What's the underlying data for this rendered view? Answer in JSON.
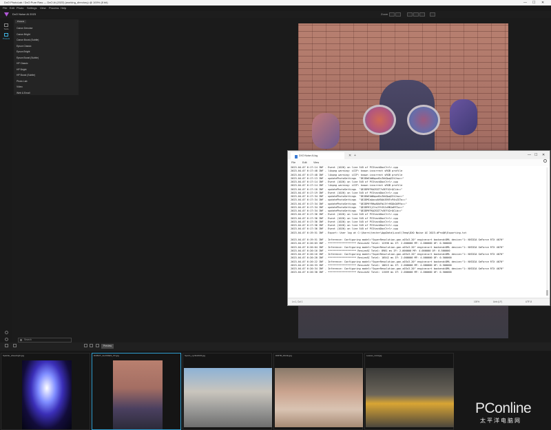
{
  "window": {
    "title": "DxO PhotoLab / DxO Pure Raw — DxO Ai (2023) (working_directory) @ 100% (8 bit)",
    "min": "—",
    "max": "☐",
    "close": "✕"
  },
  "menu": [
    "File",
    "Edit",
    "Photo",
    "Settings",
    "View",
    "Process",
    "Help"
  ],
  "app": {
    "name": "DxO Noise AI 2023"
  },
  "zoom": {
    "label": "Zoom"
  },
  "tools": [
    {
      "label": "Tools",
      "icon": "tools-icon"
    },
    {
      "label": "Presets",
      "icon": "presets-icon"
    }
  ],
  "presets": {
    "tab": "Presets",
    "items": [
      "Canon Denoise",
      "Canon Bright",
      "Canon Boost (Subtle)",
      "Epson Classic",
      "Epson Bright",
      "Epson Boost (Subtle)",
      "HP Classic",
      "HP Bright",
      "HP Boost (Subtle)",
      "Photo Lab",
      "Video",
      "Web & Email"
    ]
  },
  "search": {
    "placeholder": "Search"
  },
  "filmstrip": {
    "preview_label": "Preview",
    "items": [
      {
        "name": "Sparkle_wheelnight.jpg",
        "selected": false
      },
      {
        "name": "ROBOT_GLASSES_XX.jpg",
        "selected": true
      },
      {
        "name": "Sports_cyclist2023.jpg",
        "selected": false
      },
      {
        "name": "DIRTB_RACE.jpg",
        "selected": false
      },
      {
        "name": "Leaves_Cold.jpg",
        "selected": false
      }
    ]
  },
  "log": {
    "tab_title": "DXO Noise AI.log",
    "menu": [
      "File",
      "Edit",
      "View"
    ],
    "lines": [
      "2023-04-07 6:17:14 INF - Event (1026) on line 545 of PCStackDocCtrlr.cpp",
      "2023-04-07 6:17:48 INF - libpng warning: iCCP: known incorrect sRGB profile",
      "2023-04-07 6:17:48 INF - libpng warning: iCCP: known incorrect sRGB profile",
      "2023-04-07 6:17:13 INF - updatePhotoSettings  \"DEJDWCkWUqodGcZkUQwqS3tJsw==\"",
      "2023-04-07 6:17:14 INF - Event (1026) on line 545 of PCStackDocCtrlr.cpp",
      "2023-04-07 6:17:14 INF - libpng warning: iCCP: known incorrect sRGB profile",
      "2023-04-07 6:17:18 INF - updatePhotoSettings  \"QEJDMYFKAZGGT7s5EF42rQCLb==\"",
      "2023-04-07 6:17:19 INF - Event (1026) on line 545 of PCStackDocCtrlr.cpp",
      "2023-04-07 6:17:34 INF - updatePhotoSettings  \"DEJDWCkWUqodGcZkUQwqS3tJsw==\"",
      "2023-04-07 6:17:34 INF - updatePhotoSettings  \"QEJDMCaAocoAH5Ak3EKFcPAnZGTo==\"",
      "2023-04-07 6:17:34 INF - updatePhotoSettings  \"QEJDMYfRHwA8kFbL5YrHSQkQU9Yo==\"",
      "2023-04-07 6:17:34 INF - updatePhotoSettings  \"QEJDMf2jCtsJYtSSJxRN1aRFIw==\"",
      "2023-04-07 6:17:34 INF - updatePhotoSettings  \"QEJDMYFKAZGGT7s5EF42rQCLb==\"",
      "2023-04-07 6:17:36 INF - Event (1026) on line 545 of PCStackDocCtrlr.cpp",
      "2023-04-07 6:17:36 INF - Event (1026) on line 545 of PCStackDocCtrlr.cpp",
      "2023-04-07 6:17:36 INF - Event (1026) on line 545 of PCStackDocCtrlr.cpp",
      "2023-04-07 6:17:36 INF - Event (1026) on line 545 of PCStackDocCtrlr.cpp",
      "2023-04-07 6:17:36 INF - Event (1026) on line 545 of PCStackDocCtrlr.cpp",
      "2023-04-07 6:19:51 INF - Export: User log at C:\\Users\\tester\\AppData\\Local\\Temp\\DXO Noise AI 2023-dProQ6\\Exporting.txt",
      "",
      "2023-04-07 6:19:51 INF - Inference: Configuring model=\"SuperResolution.gan.x03x3.20\" engine=ort backend=DML device=\"1: NVIDIA GeForce RTX 4070\"",
      "2023-04-07 6:20:03 INF - ******************* ResizeAI Total: 12398 ms IF: 2.000000 MF: 4.000000 OF: 0.500000",
      "2023-04-07 6:20:04 INF - Inference: Configuring model=\"SuperResolution.gan.x03x3.20\" engine=ort backend=DML device=\"1: NVIDIA GeForce RTX 4070\"",
      "2023-04-07 6:20:16 INF - ******************* ResizeAI Total: 8981 ms IF: 2.000000 MF: 4.000000 OF: 0.500000",
      "2023-04-07 6:20:16 INF - Inference: Configuring model=\"SuperResolution.gan.x03x3.20\" engine=ort backend=DML device=\"1: NVIDIA GeForce RTX 4070\"",
      "2023-04-07 6:20:20 INF - ******************* ResizeAI Total: 10542 ms IF: 2.000000 MF: 4.000000 OF: 0.500000",
      "2023-04-07 6:20:22 INF - Inference: Configuring model=\"SuperResolution.gan.x03x3.20\" engine=ort backend=DML device=\"1: NVIDIA GeForce RTX 4070\"",
      "2023-04-07 6:20:33 INF - ******************* ResizeAI Total: 10613 ms IF: 2.000000 MF: 4.000000 OF: 0.500000",
      "2023-04-07 6:20:34 INF - Inference: Configuring model=\"SuperResolution.gan.x03x3.20\" engine=ort backend=DML device=\"1: NVIDIA GeForce RTX 4070\"",
      "2023-04-07 6:20:38 INF - ******************* ResizeAI Total: 11569 ms IF: 2.000000 MF: 4.000000 OF: 0.500000"
    ],
    "status": {
      "pos": "Ln 1, Col 1",
      "zoom": "100%",
      "eol": "Unix (LF)",
      "enc": "UTF-8"
    }
  },
  "watermark": {
    "brand": "PConline",
    "sub": "太平洋电脑网"
  }
}
